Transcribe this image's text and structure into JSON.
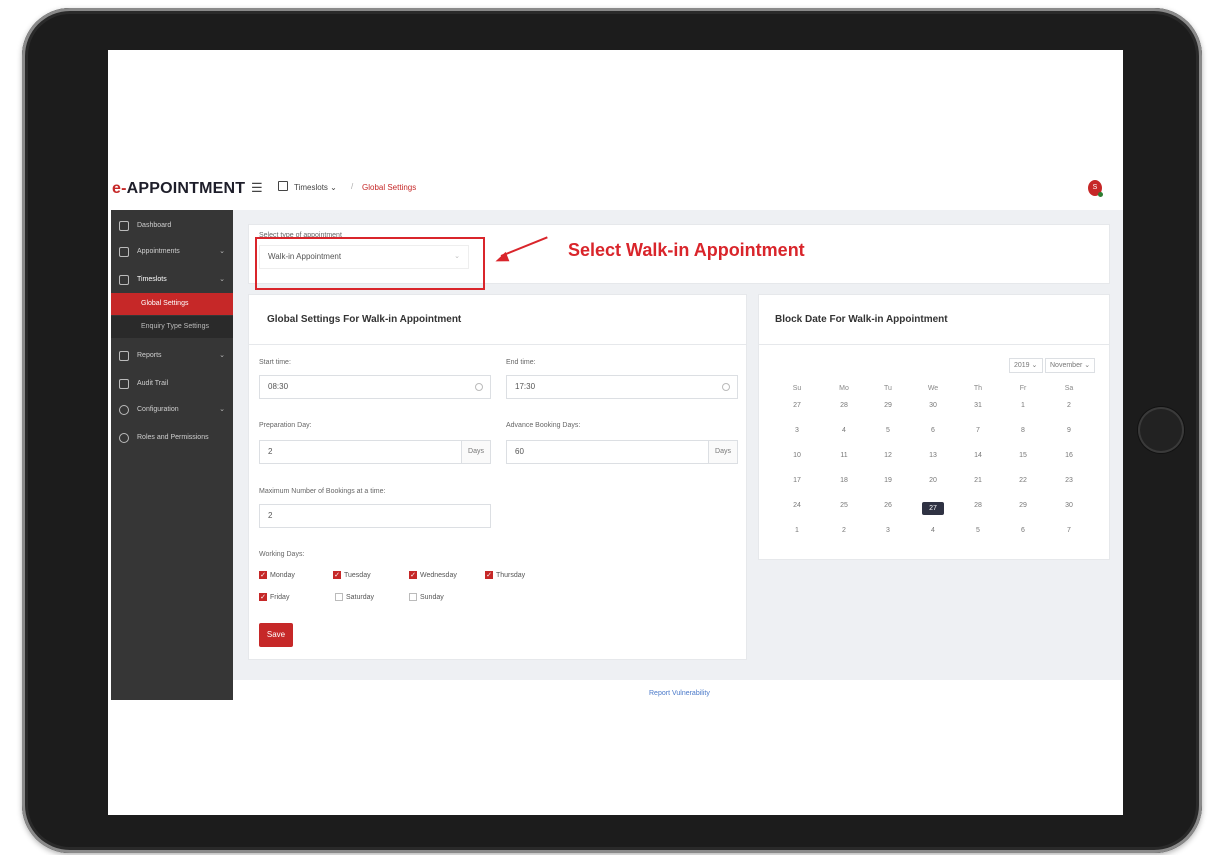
{
  "app": {
    "logo_prefix": "e-",
    "logo_main": "APPOINTMENT",
    "breadcrumb_menu": "Timeslots ⌄",
    "breadcrumb_current": "Global Settings",
    "avatar_initial": "S"
  },
  "sidebar": {
    "items": [
      {
        "label": "Dashboard"
      },
      {
        "label": "Appointments"
      },
      {
        "label": "Timeslots"
      },
      {
        "label": "Global Settings"
      },
      {
        "label": "Enquiry Type Settings"
      },
      {
        "label": "Reports"
      },
      {
        "label": "Audit Trail"
      },
      {
        "label": "Configuration"
      },
      {
        "label": "Roles and Permissions"
      }
    ]
  },
  "type_selector": {
    "label": "Select type of appointment",
    "value": "Walk-in Appointment"
  },
  "callout": "Select Walk-in Appointment",
  "global_settings": {
    "title": "Global Settings For Walk-in Appointment",
    "start_time_label": "Start time:",
    "start_time": "08:30",
    "end_time_label": "End time:",
    "end_time": "17:30",
    "prep_label": "Preparation Day:",
    "prep_value": "2",
    "prep_suffix": "Days",
    "advance_label": "Advance Booking Days:",
    "advance_value": "60",
    "advance_suffix": "Days",
    "max_label": "Maximum Number of Bookings at a time:",
    "max_value": "2",
    "working_days_label": "Working Days:",
    "days": [
      {
        "label": "Monday",
        "checked": true
      },
      {
        "label": "Tuesday",
        "checked": true
      },
      {
        "label": "Wednesday",
        "checked": true
      },
      {
        "label": "Thursday",
        "checked": true
      },
      {
        "label": "Friday",
        "checked": true
      },
      {
        "label": "Saturday",
        "checked": false
      },
      {
        "label": "Sunday",
        "checked": false
      }
    ],
    "save_label": "Save"
  },
  "block_date": {
    "title": "Block Date For Walk-in Appointment",
    "year": "2019 ⌄",
    "month": "November ⌄",
    "weekdays": [
      "Su",
      "Mo",
      "Tu",
      "We",
      "Th",
      "Fr",
      "Sa"
    ],
    "weeks": [
      [
        "27",
        "28",
        "29",
        "30",
        "31",
        "1",
        "2"
      ],
      [
        "3",
        "4",
        "5",
        "6",
        "7",
        "8",
        "9"
      ],
      [
        "10",
        "11",
        "12",
        "13",
        "14",
        "15",
        "16"
      ],
      [
        "17",
        "18",
        "19",
        "20",
        "21",
        "22",
        "23"
      ],
      [
        "24",
        "25",
        "26",
        "27",
        "28",
        "29",
        "30"
      ],
      [
        "1",
        "2",
        "3",
        "4",
        "5",
        "6",
        "7"
      ]
    ],
    "selected": "27"
  },
  "footer": {
    "link": "Report Vulnerability"
  },
  "colors": {
    "accent": "#c62828",
    "sidebar": "#363636",
    "annotation": "#d9252b"
  }
}
